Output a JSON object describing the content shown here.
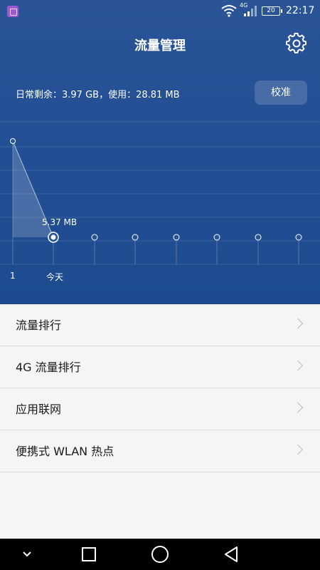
{
  "status_bar": {
    "network": "4G",
    "battery": "20",
    "time": "22:17"
  },
  "header": {
    "title": "流量管理",
    "settings_icon": "gear-icon"
  },
  "summary": {
    "daily_text": "日常剩余：3.97 GB，使用：28.81 MB",
    "calibrate_label": "校准"
  },
  "chart_data": {
    "type": "line",
    "peak_label": "5.37 MB",
    "x_labels": [
      "1",
      "今天"
    ],
    "points": [
      {
        "label": "1",
        "value": 1
      },
      {
        "label": "今天",
        "value": 0
      }
    ],
    "future_points": 6
  },
  "list": {
    "items": [
      {
        "label": "流量排行"
      },
      {
        "label": "4G 流量排行"
      },
      {
        "label": "应用联网"
      },
      {
        "label": "便携式 WLAN 热点"
      }
    ]
  },
  "colors": {
    "header_bg": "#234f95",
    "list_bg": "#f5f5f5",
    "nav_bg": "#000000"
  }
}
